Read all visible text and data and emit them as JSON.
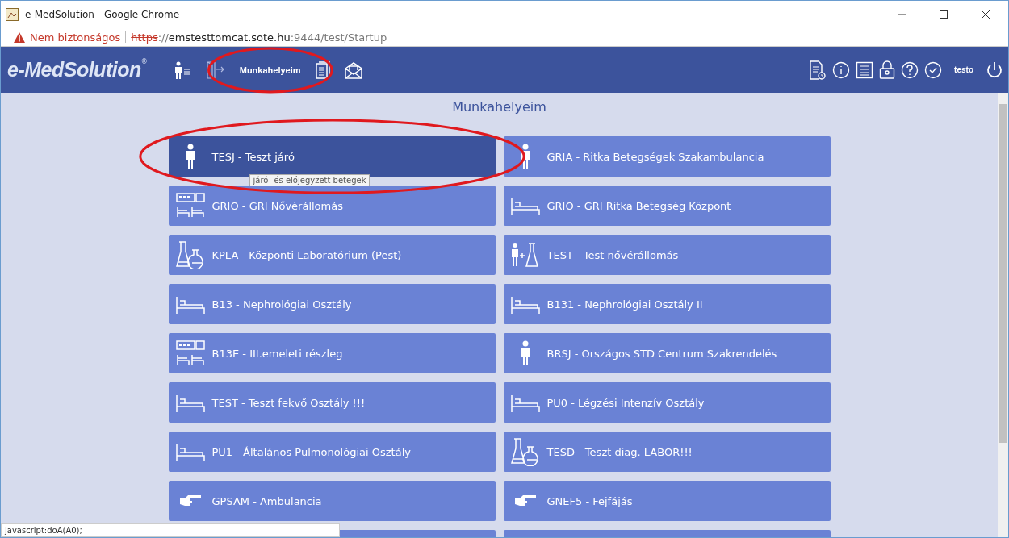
{
  "window": {
    "title": "e-MedSolution - Google Chrome"
  },
  "address_bar": {
    "warning": "Nem biztonságos",
    "scheme": "https",
    "separator": "://",
    "host": "emstesttomcat.sote.hu",
    "path": ":9444/test/Startup"
  },
  "header": {
    "logo": "e-MedSolution",
    "logo_mark": "®",
    "nav": [
      {
        "kind": "patient-list"
      },
      {
        "kind": "door"
      },
      {
        "kind": "label",
        "label": "Munkahelyeim",
        "highlighted": true
      },
      {
        "kind": "document"
      },
      {
        "kind": "mail"
      }
    ],
    "tools": [
      {
        "kind": "report"
      },
      {
        "kind": "info"
      },
      {
        "kind": "calculator"
      },
      {
        "kind": "lock"
      },
      {
        "kind": "help"
      },
      {
        "kind": "check"
      },
      {
        "kind": "user",
        "label": "testo"
      },
      {
        "kind": "power"
      }
    ]
  },
  "page": {
    "title": "Munkahelyeim"
  },
  "tiles": [
    {
      "kind": "person",
      "label": "TESJ - Teszt járó",
      "selected": true,
      "highlighted": true,
      "tooltip": "járó- és előjegyzett betegek"
    },
    {
      "kind": "person",
      "label": "GRIA - Ritka Betegségek Szakambulancia",
      "selected": false,
      "highlighted": false
    },
    {
      "kind": "ward",
      "label": "GRIO - GRI Nővérállomás",
      "selected": false,
      "highlighted": false
    },
    {
      "kind": "bed",
      "label": "GRIO - GRI Ritka Betegség Központ",
      "selected": false,
      "highlighted": false
    },
    {
      "kind": "lab",
      "label": "KPLA - Központi Laboratórium (Pest)",
      "selected": false,
      "highlighted": false
    },
    {
      "kind": "person-lab",
      "label": "TEST - Test nővérállomás",
      "selected": false,
      "highlighted": false
    },
    {
      "kind": "bed",
      "label": "B13 - Nephrológiai Osztály",
      "selected": false,
      "highlighted": false
    },
    {
      "kind": "bed",
      "label": "B131 - Nephrológiai Osztály II",
      "selected": false,
      "highlighted": false
    },
    {
      "kind": "ward",
      "label": "B13E - III.emeleti részleg",
      "selected": false,
      "highlighted": false
    },
    {
      "kind": "person",
      "label": "BRSJ - Országos STD Centrum Szakrendelés",
      "selected": false,
      "highlighted": false
    },
    {
      "kind": "bed",
      "label": "TEST - Teszt fekvő Osztály !!!",
      "selected": false,
      "highlighted": false
    },
    {
      "kind": "bed",
      "label": "PU0 - Légzési Intenzív Osztály",
      "selected": false,
      "highlighted": false
    },
    {
      "kind": "bed",
      "label": "PU1 - Általános Pulmonológiai Osztály",
      "selected": false,
      "highlighted": false
    },
    {
      "kind": "lab",
      "label": "TESD - Teszt diag. LABOR!!!",
      "selected": false,
      "highlighted": false
    },
    {
      "kind": "hand",
      "label": "GPSAM - Ambulancia",
      "selected": false,
      "highlighted": false
    },
    {
      "kind": "hand",
      "label": "GNEF5 - Fejfájás",
      "selected": false,
      "highlighted": false
    }
  ],
  "more_tiles_below": true,
  "status_bar": {
    "text": "javascript:doA(A0);"
  }
}
